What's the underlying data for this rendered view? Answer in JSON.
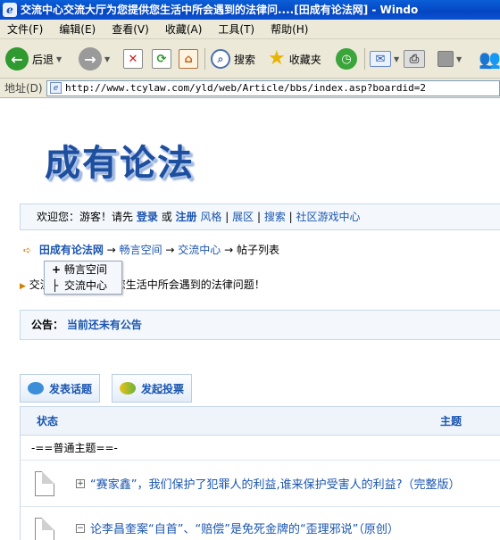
{
  "window": {
    "title": "交流中心交流大厅为您提供您生活中所会遇到的法律问....[田成有论法网] - Windo"
  },
  "menu": [
    "文件(F)",
    "编辑(E)",
    "查看(V)",
    "收藏(A)",
    "工具(T)",
    "帮助(H)"
  ],
  "toolbar": {
    "back_label": "后退",
    "search_label": "搜索",
    "favorites_label": "收藏夹"
  },
  "address": {
    "label": "地址(D)",
    "url": "http://www.tcylaw.com/yld/web/Article/bbs/index.asp?boardid=2"
  },
  "site": {
    "logo_text": "成有论法",
    "welcome": {
      "prefix": "欢迎您：游客！请先",
      "login": "登录",
      "or": "或",
      "register": "注册",
      "links": [
        "风格",
        "展区",
        "搜索",
        "社区游戏中心"
      ]
    },
    "breadcrumb": {
      "home": "田成有论法网",
      "level1": "畅言空间",
      "level2": "交流中心",
      "current": "帖子列表"
    },
    "dropdown": [
      {
        "symbol": "+",
        "label": "畅言空间"
      },
      {
        "symbol": "├",
        "label": "交流中心"
      }
    ],
    "ticker_text": "交流大厅为您提供您生活中所会遇到的法律问题！",
    "notice": {
      "label": "公告：",
      "text": "当前还未有公告"
    },
    "buttons": {
      "post": "发表话题",
      "vote": "发起投票"
    },
    "table": {
      "col_status": "状态",
      "col_topic": "主题",
      "group_label": "-==普通主题==-",
      "rows": [
        {
          "expander": "+",
          "title": "“赛家鑫”，我们保护了犯罪人的利益,谁来保护受害人的利益?（完整版）"
        },
        {
          "expander": "−",
          "title": "论李昌奎案“自首”、“赔偿”是免死金牌的“歪理邪说”（原创）"
        }
      ]
    }
  }
}
